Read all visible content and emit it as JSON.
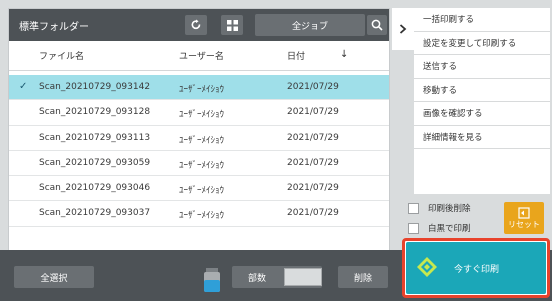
{
  "header": {
    "folder_title": "標準フォルダー",
    "job_filter": "全ジョブ"
  },
  "table": {
    "columns": [
      "ファイル名",
      "ユーザー名",
      "日付"
    ],
    "rows": [
      {
        "file": "Scan_20210729_093142",
        "user": "ﾕｰｻﾞｰﾒｲｼｮｳ",
        "date": "2021/07/29",
        "selected": true
      },
      {
        "file": "Scan_20210729_093128",
        "user": "ﾕｰｻﾞｰﾒｲｼｮｳ",
        "date": "2021/07/29",
        "selected": false
      },
      {
        "file": "Scan_20210729_093113",
        "user": "ﾕｰｻﾞｰﾒｲｼｮｳ",
        "date": "2021/07/29",
        "selected": false
      },
      {
        "file": "Scan_20210729_093059",
        "user": "ﾕｰｻﾞｰﾒｲｼｮｳ",
        "date": "2021/07/29",
        "selected": false
      },
      {
        "file": "Scan_20210729_093046",
        "user": "ﾕｰｻﾞｰﾒｲｼｮｳ",
        "date": "2021/07/29",
        "selected": false
      },
      {
        "file": "Scan_20210729_093037",
        "user": "ﾕｰｻﾞｰﾒｲｼｮｳ",
        "date": "2021/07/29",
        "selected": false
      }
    ]
  },
  "footer": {
    "select_all": "全選択",
    "copies_label": "部数",
    "delete": "削除"
  },
  "menu": {
    "items": [
      "一括印刷する",
      "設定を変更して印刷する",
      "送信する",
      "移動する",
      "画像を確認する",
      "詳細情報を見る"
    ]
  },
  "options": {
    "delete_after_print": "印刷後削除",
    "print_bw": "白黒で印刷"
  },
  "reset_label": "リセット",
  "print_now": "今すぐ印刷",
  "colors": {
    "accent": "#1ba7b8",
    "selected_row": "#9fdfe9",
    "reset": "#e9a51c",
    "highlight_border": "#e8432c",
    "dark_bar": "#4d5256"
  },
  "icons": {
    "refresh": "refresh-icon",
    "grid": "grid-icon",
    "search": "search-icon",
    "sort": "sort-down-icon",
    "chevron": "chevron-right-icon",
    "toner": "toner-icon",
    "print": "print-diamond-icon"
  }
}
